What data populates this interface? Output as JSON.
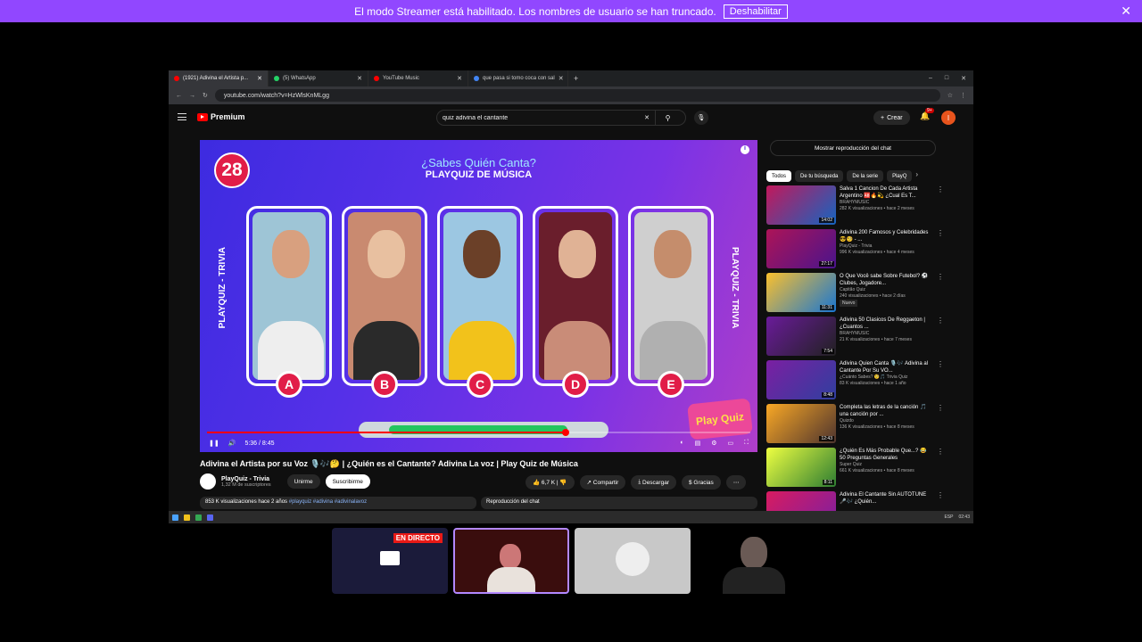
{
  "banner": {
    "message": "El modo Streamer está habilitado. Los nombres de usuario se han truncado.",
    "button": "Deshabilitar",
    "close": "✕"
  },
  "browser": {
    "tabs": [
      {
        "label": "(1921) Adivina el Artista p...",
        "color": "#ff0000"
      },
      {
        "label": "(5) WhatsApp",
        "color": "#25d366"
      },
      {
        "label": "YouTube Music",
        "color": "#ff0000"
      },
      {
        "label": "que pasa si tomo coca con sal",
        "color": "#4285f4"
      }
    ],
    "url": "youtube.com/watch?v=HzWlsKnMLgg"
  },
  "youtube": {
    "logo": "Premium",
    "search_value": "quiz adivina el cantante",
    "create": "Crear",
    "notif_badge": "9+",
    "avatar_letter": "I"
  },
  "player": {
    "question_number": "28",
    "title_line1": "¿Sabes Quién Canta?",
    "title_line2": "PLAYQUIZ DE MÚSICA",
    "side_label": "PLAYQUIZ - TRIVIA",
    "options": [
      "A",
      "B",
      "C",
      "D",
      "E"
    ],
    "time": "5:36 / 8:45",
    "logo_text": "Play Quiz",
    "progress": 0.66
  },
  "video": {
    "title": "Adivina el Artista por su Voz 🎙️🎶🤔 | ¿Quién es el Cantante? Adivina La voz | Play Quiz de Música",
    "channel": "PlayQuiz - Trivia",
    "subscribers": "1,32 M de suscriptores",
    "join": "Unirme",
    "subscribe": "Suscribirme",
    "likes": "6,7 K",
    "share": "Compartir",
    "download": "Descargar",
    "thanks": "Gracias",
    "desc_stats": "853 K visualizaciones  hace 2 años",
    "desc_tags": "#playquiz #adivina #adivinalavoz",
    "chat_replay": "Reproducción del chat"
  },
  "sidebar": {
    "show_chat": "Mostrar reproducción del chat",
    "chips": [
      "Todos",
      "De tu búsqueda",
      "De la serie",
      "PlayQ"
    ],
    "recs": [
      {
        "title": "Salva 1 Cancion De Cada Artista Argentino 🆎🔥💫 ¿Cual Es T...",
        "channel": "BRAHYMUSIC",
        "meta": "282 K visualizaciones • hace 2 meses",
        "duration": "14:02",
        "c1": "#c2185b",
        "c2": "#1565c0"
      },
      {
        "title": "Adivina 200 Famosos y Celebridades 😎🧐 - ...",
        "channel": "PlayQuiz - Trivia",
        "meta": "996 K visualizaciones • hace 4 meses",
        "duration": "27:17",
        "c1": "#ad1457",
        "c2": "#4a148c"
      },
      {
        "title": "O Que Você sabe Sobre Futebol? ⚽ Clubes, Jogadore...",
        "channel": "Capitão Quiz",
        "meta": "240 visualizaciones • hace 2 días",
        "duration": "11:31",
        "badge": "Nuevo",
        "c1": "#fbc02d",
        "c2": "#1976d2"
      },
      {
        "title": "Adivina 50 Clasicos De Reggaeton | ¿Cuantos ...",
        "channel": "BRAHYMUSIC",
        "meta": "21 K visualizaciones • hace 7 meses",
        "duration": "7:54",
        "c1": "#6a1b9a",
        "c2": "#212121"
      },
      {
        "title": "Adivina Quien Canta 🎙️🎶 Adivina al Cantante Por Su VO...",
        "channel": "¿Cuánto Sabes? 🧐🎵 Trivia Quiz",
        "meta": "83 K visualizaciones • hace 1 año",
        "duration": "8:48",
        "c1": "#7b1fa2",
        "c2": "#303f9f"
      },
      {
        "title": "Completa las letras de la canción 🎵 una canción por ...",
        "channel": "Quizdo",
        "meta": "136 K visualizaciones • hace 8 meses",
        "duration": "12:43",
        "c1": "#f9a825",
        "c2": "#4e342e"
      },
      {
        "title": "¿Quién Es Más Probable Que...? 😂 50 Preguntas Generales",
        "channel": "Super Quiz",
        "meta": "661 K visualizaciones • hace 8 meses",
        "duration": "8:11",
        "c1": "#eeff41",
        "c2": "#2e7d32"
      },
      {
        "title": "Adivina El Cantante Sin AUTOTUNE 🎤🎶 ¿Quién...",
        "channel": "",
        "meta": "",
        "duration": "",
        "c1": "#d81b60",
        "c2": "#7b1fa2"
      }
    ]
  },
  "taskbar": {
    "lang": "ESP",
    "clock": "02:43"
  },
  "stream": {
    "live_label": "EN DIRECTO"
  }
}
